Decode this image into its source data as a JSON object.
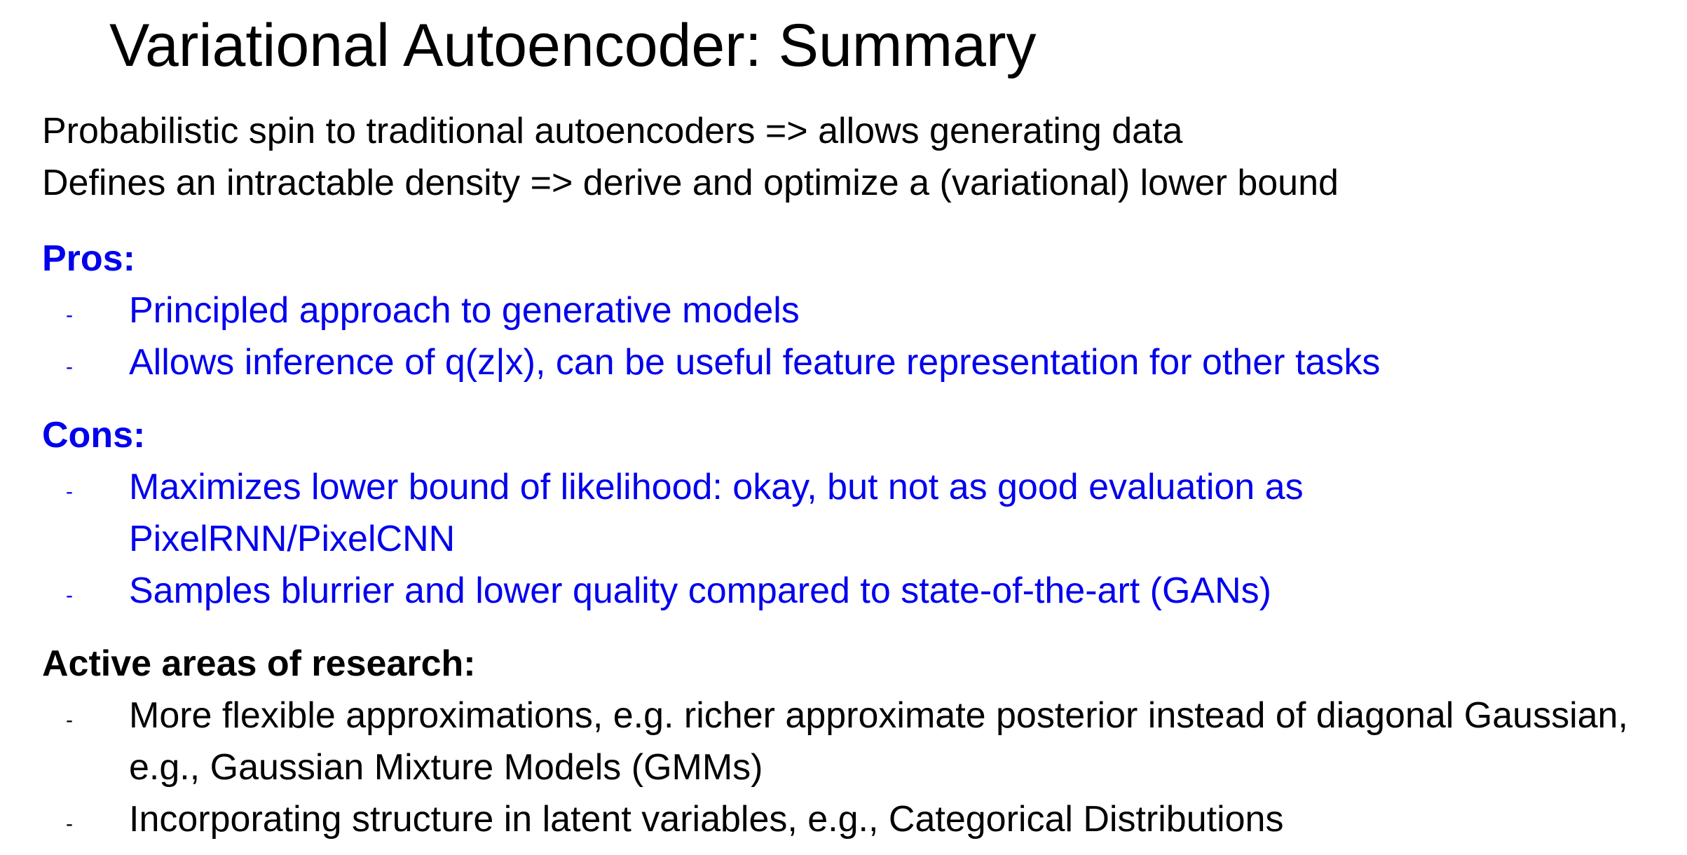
{
  "title": "Variational Autoencoder: Summary",
  "intro": [
    "Probabilistic spin to traditional autoencoders => allows generating data",
    "Defines an intractable density => derive and optimize a (variational) lower bound"
  ],
  "colors": {
    "accent": "#0000ee",
    "text": "#000000",
    "background": "#ffffff"
  },
  "bullet_marker": "-",
  "pros": {
    "heading": "Pros:",
    "items": [
      "Principled approach to generative models",
      "Allows inference of q(z|x), can be useful feature representation for other tasks"
    ]
  },
  "cons": {
    "heading": "Cons:",
    "items": [
      "Maximizes lower bound of likelihood: okay, but not as good evaluation as PixelRNN/PixelCNN",
      "Samples blurrier and lower quality compared to state-of-the-art (GANs)"
    ]
  },
  "research": {
    "heading": "Active areas of research:",
    "items": [
      "More flexible approximations, e.g. richer approximate posterior instead of diagonal Gaussian, e.g., Gaussian Mixture Models (GMMs)",
      "Incorporating structure in latent variables, e.g., Categorical Distributions"
    ]
  }
}
